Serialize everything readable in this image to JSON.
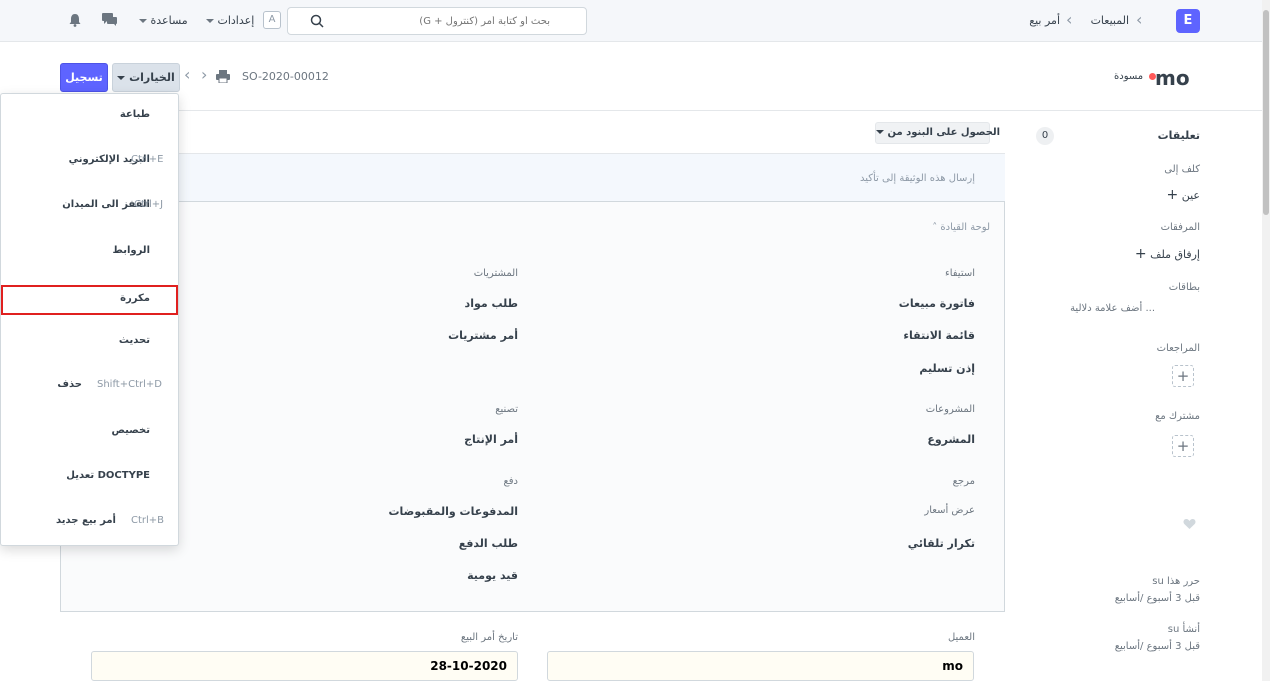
{
  "navbar": {
    "logo": "E",
    "breadcrumbs": [
      "المبيعات",
      "أمر بيع"
    ],
    "search_placeholder": "بحث أو كتابة أمر (كنترول + G)",
    "settings_label": "إعدادات",
    "settings_avatar": "A",
    "help_label": "مساعدة"
  },
  "page_head": {
    "title": "mo",
    "status": "مسودة",
    "doc_name": "SO-2020-00012",
    "actions_label": "الخيارات",
    "save_label": "تسجيل"
  },
  "sidebar": {
    "comments_label": "تعليقات",
    "comments_count": "0",
    "assign_label": "كلف إلى",
    "assign_action": "عين",
    "attachments_label": "المرفقات",
    "attach_action": "إرفاق ملف",
    "tags_label": "بطاقات",
    "add_tag": "أضف علامة دلالية ...",
    "reviews_label": "المراجعات",
    "shared_label": "مشترك مع",
    "edited_by": "su حرر هذا",
    "edited_time": "قبل 3 أسبوع /أسابيع",
    "created_by": "su أنشأ",
    "created_time": "قبل 3 أسبوع /أسابيع"
  },
  "form": {
    "get_items_label": "الحصول على البنود من",
    "intro_text": "إرسال هذه الوثيقة إلى تأكيد",
    "dashboard_label": "لوحة القيادة",
    "right_groups": [
      {
        "heading": "استيفاء",
        "links": [
          "فاتورة مبيعات",
          "قائمة الانتقاء",
          "إذن تسليم"
        ]
      },
      {
        "heading": "المشروعات",
        "links": [
          "المشروع"
        ]
      },
      {
        "heading": "مرجع",
        "links": [
          "عرض أسعار",
          "تكرار تلقائي"
        ]
      }
    ],
    "left_groups": [
      {
        "heading": "المشتريات",
        "links": [
          "طلب مواد",
          "أمر مشتريات"
        ]
      },
      {
        "heading": "تصنيع",
        "links": [
          "أمر الإنتاج"
        ]
      },
      {
        "heading": "دفع",
        "links": [
          "المدفوعات والمقبوضات",
          "طلب الدفع",
          "قيد يومية"
        ]
      }
    ],
    "customer_label": "العميل",
    "customer_value": "mo",
    "date_label": "تاريخ أمر البيع",
    "date_value": "28-10-2020"
  },
  "menu": {
    "items": [
      {
        "label": "طباعة",
        "shortcut": ""
      },
      {
        "label": "البريد الإلكتروني",
        "shortcut": "Ctrl+E"
      },
      {
        "label": "القفز الى الميدان",
        "shortcut": "Ctrl+J"
      },
      {
        "label": "الروابط",
        "shortcut": ""
      },
      {
        "label": "مكررة",
        "shortcut": ""
      },
      {
        "label": "تحديث",
        "shortcut": ""
      },
      {
        "label": "حذف",
        "shortcut": "Shift+Ctrl+D"
      },
      {
        "label": "تخصيص",
        "shortcut": ""
      },
      {
        "label": "تعديل DOCTYPE",
        "shortcut": ""
      },
      {
        "label": "أمر بيع جديد",
        "shortcut": "Ctrl+B"
      }
    ]
  },
  "colors": {
    "primary": "#5e64ff",
    "highlight": "#e0201f",
    "draft_indicator": "#ff5858"
  }
}
